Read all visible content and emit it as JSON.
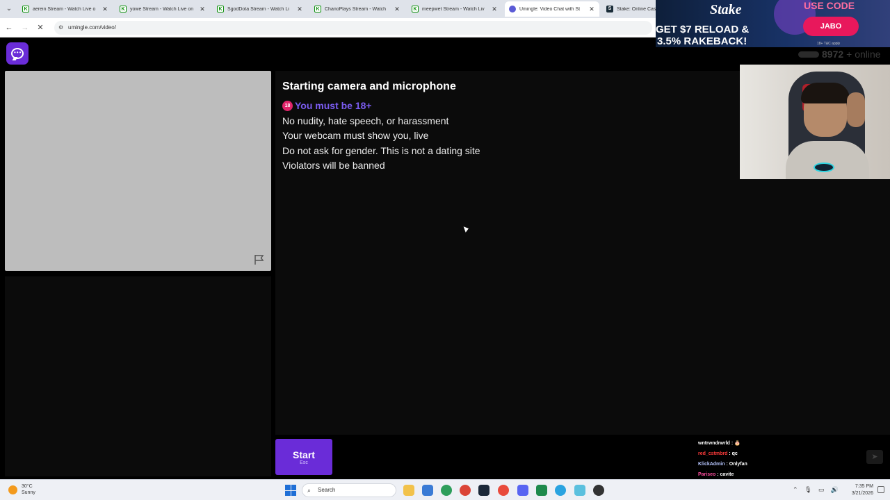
{
  "browser": {
    "tabs": [
      {
        "title": "aerein Stream - Watch Live o",
        "favicon": "kick-icon",
        "active": false
      },
      {
        "title": "yowe Stream - Watch Live on",
        "favicon": "kick-icon",
        "active": false
      },
      {
        "title": "SgodDota Stream - Watch Li",
        "favicon": "kick-icon",
        "active": false
      },
      {
        "title": "ChanoPlays Stream - Watch",
        "favicon": "kick-icon",
        "active": false
      },
      {
        "title": "meepwet Stream - Watch Liv",
        "favicon": "kick-icon",
        "active": false
      },
      {
        "title": "Umingle: Video Chat with St",
        "favicon": "umingle-icon",
        "active": true
      },
      {
        "title": "Stake: Online Casi",
        "favicon": "stake-icon",
        "active": false
      }
    ],
    "url": "umingle.com/video/"
  },
  "header": {
    "online_count": "8972",
    "online_suffix": "+ online"
  },
  "panel": {
    "title": "Starting camera and microphone",
    "age_badge": "18",
    "age_rule": "You must be 18+",
    "rules": [
      "No nudity, hate speech, or harassment",
      "Your webcam must show you, live",
      "Do not ask for gender. This is not a dating site",
      "Violators will be banned"
    ]
  },
  "start_button": {
    "label": "Start",
    "shortcut": "Esc"
  },
  "stream_overlay": {
    "ad": {
      "brand": "Stake",
      "code_label": "USE CODE",
      "code": "JABO",
      "promo_line1": "GET $7 RELOAD &",
      "promo_line2": "3.5% RAKEBACK!",
      "fine_print": "18+ T&C apply"
    },
    "chat": [
      {
        "user": "wntrwndrwrld",
        "message": "🎂",
        "color": "#ffffff"
      },
      {
        "user": "red_cstmbrd",
        "message": "qc",
        "color": "#ff3b3b"
      },
      {
        "user": "KlickAdmin",
        "message": "Onlyfan",
        "color": "#b7c6ff"
      },
      {
        "user": "Pariseo",
        "message": "cavite",
        "color": "#ff4fa0"
      }
    ]
  },
  "taskbar": {
    "weather_temp": "30°C",
    "weather_cond": "Sunny",
    "search_placeholder": "Search",
    "time": "7:35 PM",
    "date": "3/21/2026"
  },
  "colors": {
    "accent": "#6a2cd8",
    "age_text": "#7b5cf0"
  }
}
